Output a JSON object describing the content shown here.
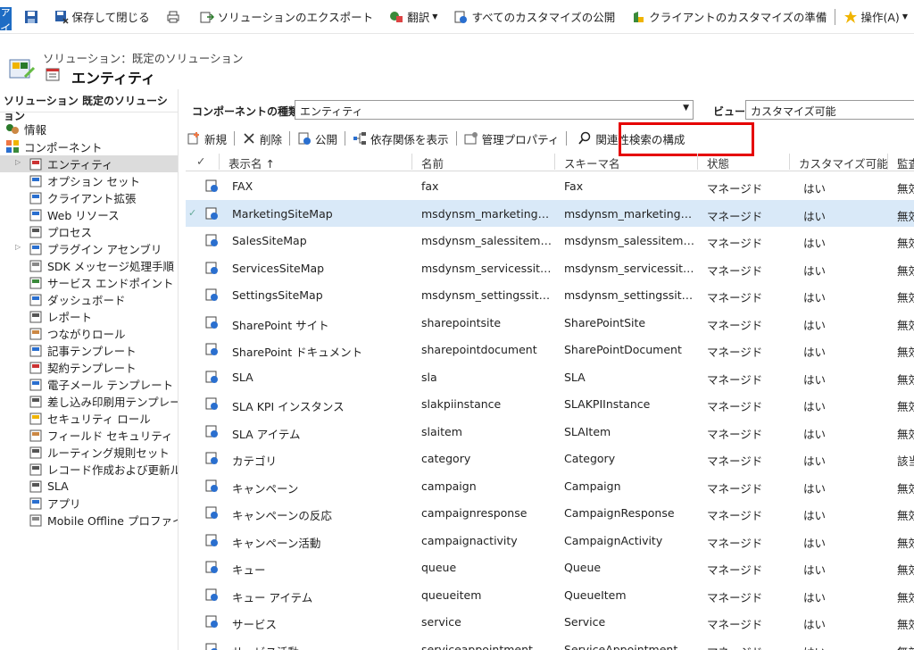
{
  "ribbon": {
    "file": "ファイル",
    "save_close": "保存して閉じる",
    "export": "ソリューションのエクスポート",
    "translate": "翻訳",
    "publish_all": "すべてのカスタマイズの公開",
    "prepare_client": "クライアントのカスタマイズの準備",
    "actions": "操作(A)"
  },
  "breadcrumb": "ソリューション：既定のソリューション",
  "page_title": "エンティティ",
  "sidebar": {
    "header": "ソリューション 既定のソリューション",
    "info": "情報",
    "components": "コンポーネント",
    "items": [
      "エンティティ",
      "オプション セット",
      "クライアント拡張",
      "Web リソース",
      "プロセス",
      "プラグイン アセンブリ",
      "SDK メッセージ処理手順",
      "サービス エンドポイント",
      "ダッシュボード",
      "レポート",
      "つながりロール",
      "記事テンプレート",
      "契約テンプレート",
      "電子メール テンプレート",
      "差し込み印刷用テンプレート",
      "セキュリティ ロール",
      "フィールド セキュリティ プロ…",
      "ルーティング規則セット",
      "レコード作成および更新ル…",
      "SLA",
      "アプリ",
      "Mobile Offline プロファイル"
    ]
  },
  "filter": {
    "component_type_label": "コンポーネントの種類",
    "component_type_value": "エンティティ",
    "view_label": "ビュー",
    "view_value": "カスタマイズ可能"
  },
  "toolbar": {
    "new": "新規",
    "delete": "削除",
    "publish": "公開",
    "show_dependencies": "依存関係を表示",
    "managed_properties": "管理プロパティ",
    "configure_relevance_search": "関連性検索の構成"
  },
  "columns": [
    "表示名 ↑",
    "名前",
    "スキーマ名",
    "状態",
    "カスタマイズ可能",
    "監査"
  ],
  "rows": [
    {
      "display": "FAX",
      "name": "fax",
      "schema": "Fax",
      "state": "マネージド",
      "custom": "はい",
      "audit": "無効"
    },
    {
      "display": "MarketingSiteMap",
      "name": "msdynsm_marketing…",
      "schema": "msdynsm_marketing…",
      "state": "マネージド",
      "custom": "はい",
      "audit": "無効"
    },
    {
      "display": "SalesSiteMap",
      "name": "msdynsm_salessitem…",
      "schema": "msdynsm_salessitem…",
      "state": "マネージド",
      "custom": "はい",
      "audit": "無効"
    },
    {
      "display": "ServicesSiteMap",
      "name": "msdynsm_servicessit…",
      "schema": "msdynsm_servicessit…",
      "state": "マネージド",
      "custom": "はい",
      "audit": "無効"
    },
    {
      "display": "SettingsSiteMap",
      "name": "msdynsm_settingssit…",
      "schema": "msdynsm_settingssit…",
      "state": "マネージド",
      "custom": "はい",
      "audit": "無効"
    },
    {
      "display": "SharePoint サイト",
      "name": "sharepointsite",
      "schema": "SharePointSite",
      "state": "マネージド",
      "custom": "はい",
      "audit": "無効"
    },
    {
      "display": "SharePoint ドキュメント",
      "name": "sharepointdocument",
      "schema": "SharePointDocument",
      "state": "マネージド",
      "custom": "はい",
      "audit": "無効"
    },
    {
      "display": "SLA",
      "name": "sla",
      "schema": "SLA",
      "state": "マネージド",
      "custom": "はい",
      "audit": "無効"
    },
    {
      "display": "SLA KPI インスタンス",
      "name": "slakpiinstance",
      "schema": "SLAKPIInstance",
      "state": "マネージド",
      "custom": "はい",
      "audit": "無効"
    },
    {
      "display": "SLA アイテム",
      "name": "slaitem",
      "schema": "SLAItem",
      "state": "マネージド",
      "custom": "はい",
      "audit": "無効"
    },
    {
      "display": "カテゴリ",
      "name": "category",
      "schema": "Category",
      "state": "マネージド",
      "custom": "はい",
      "audit": "該当"
    },
    {
      "display": "キャンペーン",
      "name": "campaign",
      "schema": "Campaign",
      "state": "マネージド",
      "custom": "はい",
      "audit": "無効"
    },
    {
      "display": "キャンペーンの反応",
      "name": "campaignresponse",
      "schema": "CampaignResponse",
      "state": "マネージド",
      "custom": "はい",
      "audit": "無効"
    },
    {
      "display": "キャンペーン活動",
      "name": "campaignactivity",
      "schema": "CampaignActivity",
      "state": "マネージド",
      "custom": "はい",
      "audit": "無効"
    },
    {
      "display": "キュー",
      "name": "queue",
      "schema": "Queue",
      "state": "マネージド",
      "custom": "はい",
      "audit": "無効"
    },
    {
      "display": "キュー アイテム",
      "name": "queueitem",
      "schema": "QueueItem",
      "state": "マネージド",
      "custom": "はい",
      "audit": "無効"
    },
    {
      "display": "サービス",
      "name": "service",
      "schema": "Service",
      "state": "マネージド",
      "custom": "はい",
      "audit": "無効"
    },
    {
      "display": "サービス活動",
      "name": "serviceappointment",
      "schema": "ServiceAppointment",
      "state": "マネージド",
      "custom": "はい",
      "audit": "無効"
    }
  ],
  "colors": {
    "accent": "#1e6cc4",
    "highlight": "#e50000",
    "selected_row": "#d9e9f8"
  }
}
